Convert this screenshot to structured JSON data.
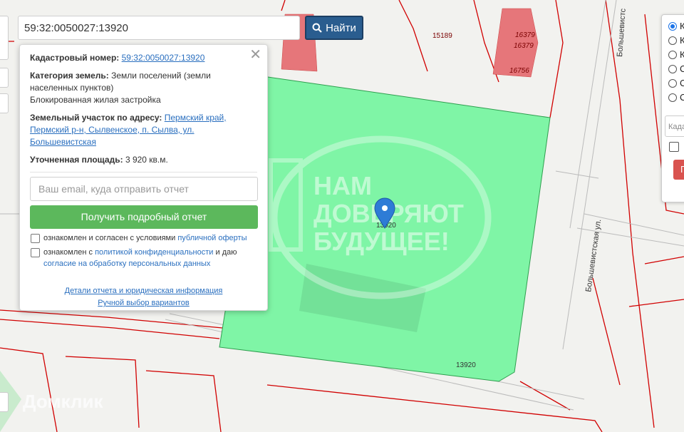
{
  "search": {
    "value": "59:32:0050027:13920",
    "button_label": "Найти"
  },
  "popup": {
    "cadastral_label": "Кадастровый номер:",
    "cadastral_value": "59:32:0050027:13920",
    "category_label": "Категория земель:",
    "category_value": "Земли поселений (земли населенных пунктов)",
    "category_sub": "Блокированная жилая застройка",
    "address_label": "Земельный участок по адресу:",
    "address_value": "Пермский край, Пермский р-н, Сылвенское, п. Сылва, ул. Большевистская",
    "area_label": "Уточненная площадь:",
    "area_value": "3 920 кв.м.",
    "email_placeholder": "Ваш email, куда отправить отчет",
    "report_button": "Получить подробный отчет",
    "consent1_text": "ознакомлен и согласен с условиями ",
    "consent1_link": "публичной оферты",
    "consent2_text": "ознакомлен с ",
    "consent2_link": "политикой конфиденциальности",
    "consent2_tail": " и даю",
    "consent2_link2": "согласие на обработку персональных данных",
    "link_details": "Детали отчета и юридическая информация",
    "link_manual": "Ручной выбор вариантов",
    "close_icon": "close-icon"
  },
  "map": {
    "parcel_labels": [
      "13920",
      "15189",
      "16379",
      "16379",
      "16756",
      "13920"
    ],
    "street_label": "Большевистская ул.",
    "street_label_top": "Большевистс",
    "watermark_lines": [
      "НАМ",
      "ДОВЕРЯЮТ",
      "БУДУЩЕЕ!"
    ],
    "brand_watermark": "Домклик",
    "marker_icon": "map-pin-icon",
    "colors": {
      "selected_parcel": "#7ff5a6",
      "parcel_border": "#d10000",
      "building": "#e6767a",
      "marker": "#2e7cd6"
    }
  },
  "right_panel": {
    "radio_labels": [
      "К",
      "К",
      "К",
      "С",
      "С",
      "С"
    ],
    "input_placeholder": "Када",
    "button_label": "П"
  }
}
